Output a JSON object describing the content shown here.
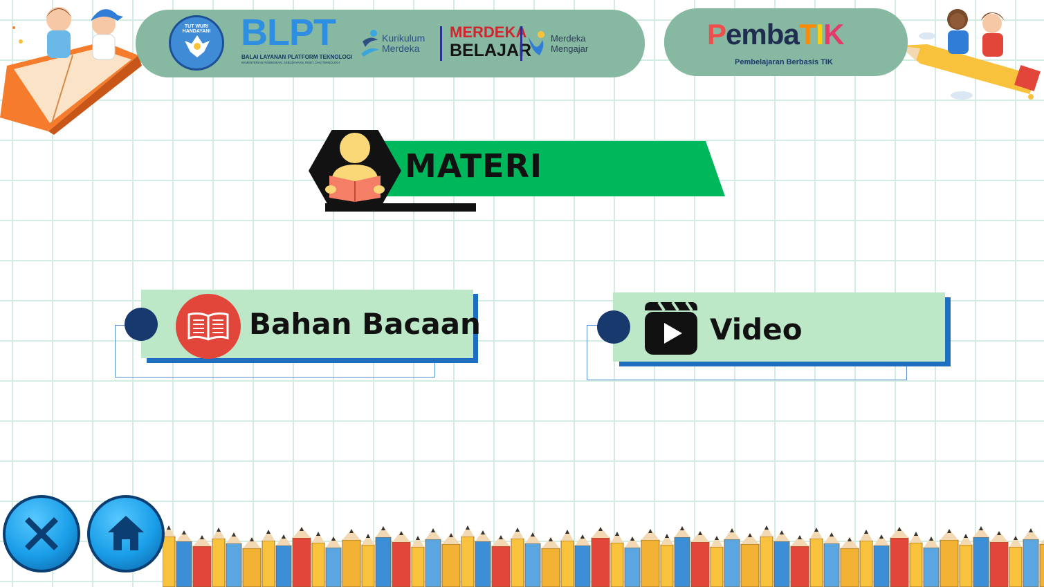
{
  "header": {
    "blpt_title": "BLPT",
    "blpt_subtitle": "BALAI LAYANAN PLATFORM TEKNOLOGI",
    "blpt_ministry": "KEMENTERIAN PENDIDIKAN, KEBUDAYAAN, RISET, DAN TEKNOLOGI",
    "emblem_text": "TUT WURI HANDAYANI",
    "kurikulum_line1": "Kurikulum",
    "kurikulum_line2": "Merdeka",
    "merdeka_belajar_line1": "MERDEKA",
    "merdeka_belajar_line2": "BELAJAR",
    "merdeka_mengajar_line1": "Merdeka",
    "merdeka_mengajar_line2": "Mengajar",
    "pembatik_logo_p": "P",
    "pembatik_logo_emba": "emba",
    "pembatik_logo_t": "T",
    "pembatik_logo_i": "I",
    "pembatik_logo_k": "K",
    "pembatik_subtitle": "Pembelajaran Berbasis TIK"
  },
  "title": {
    "label": "MATERI",
    "icon": "reader-icon"
  },
  "menu": [
    {
      "label": "Bahan Bacaan",
      "icon": "book-icon"
    },
    {
      "label": "Video",
      "icon": "video-play-icon"
    }
  ],
  "controls": {
    "close_icon": "close-icon",
    "home_icon": "home-icon"
  },
  "colors": {
    "background": "#ffffff",
    "grid": "#d4ede3",
    "header_pill": "#86b8a2",
    "title_bar": "#00b85c",
    "card_fill": "#bde8c7",
    "card_shadow": "#1f6fc1",
    "dot": "#17396e",
    "book_circle": "#e2453a",
    "button_blue": "#1a9ee8"
  }
}
